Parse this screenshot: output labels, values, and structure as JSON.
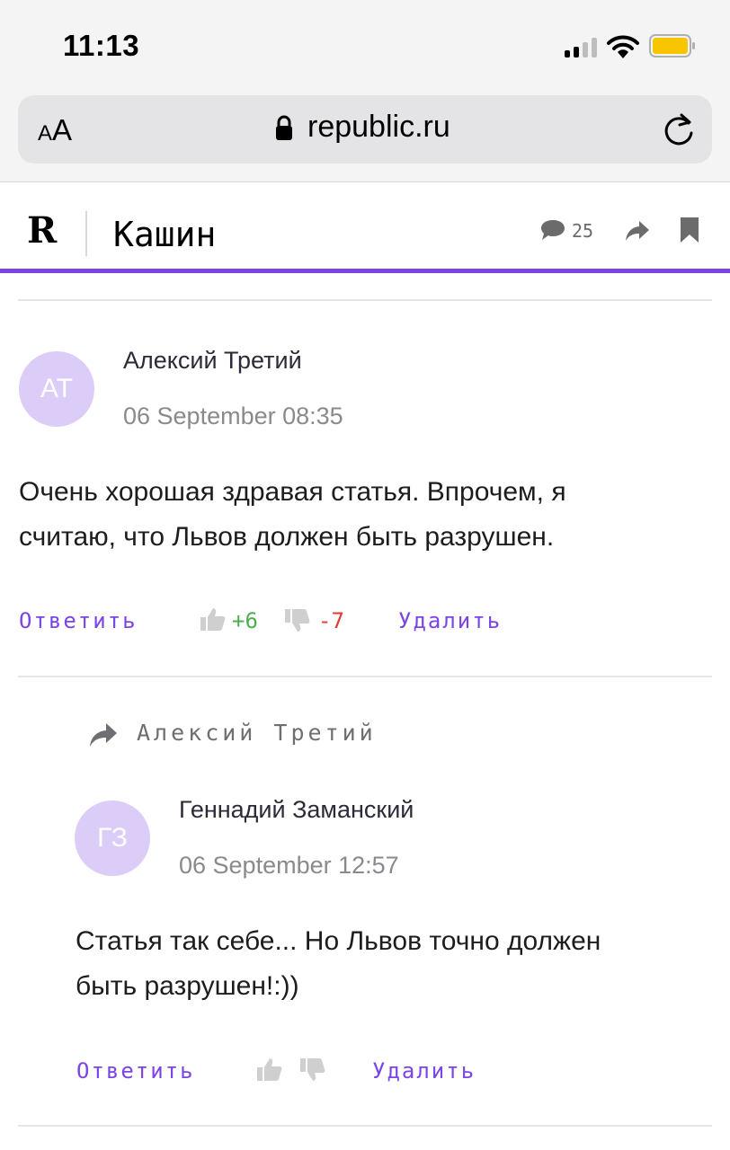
{
  "status_bar": {
    "time": "11:13"
  },
  "browser": {
    "text_size_small": "A",
    "text_size_big": "A",
    "url": "republic.ru"
  },
  "site": {
    "logo": "R",
    "article_title": "Кашин",
    "comments_count": "25"
  },
  "comments": [
    {
      "avatar_initials": "АТ",
      "author": "Алексий Третий",
      "date": "06 September 08:35",
      "body_line1": "Очень хорошая здравая статья. Впрочем, я",
      "body_line2": "считаю, что Львов должен быть разрушен.",
      "reply_label": "Ответить",
      "likes": "+6",
      "dislikes": "-7",
      "delete_label": "Удалить"
    },
    {
      "reply_to": "Алексий Третий",
      "avatar_initials": "ГЗ",
      "author": "Геннадий Заманский",
      "date": "06 September 12:57",
      "body_line1": "Статья так себе... Но Львов точно должен",
      "body_line2": "быть разрушен!:))",
      "reply_label": "Ответить",
      "delete_label": "Удалить"
    }
  ],
  "colors": {
    "accent": "#7b45e6",
    "avatar_bg": "#dccdf8",
    "positive": "#4caf50",
    "negative": "#e53935"
  }
}
